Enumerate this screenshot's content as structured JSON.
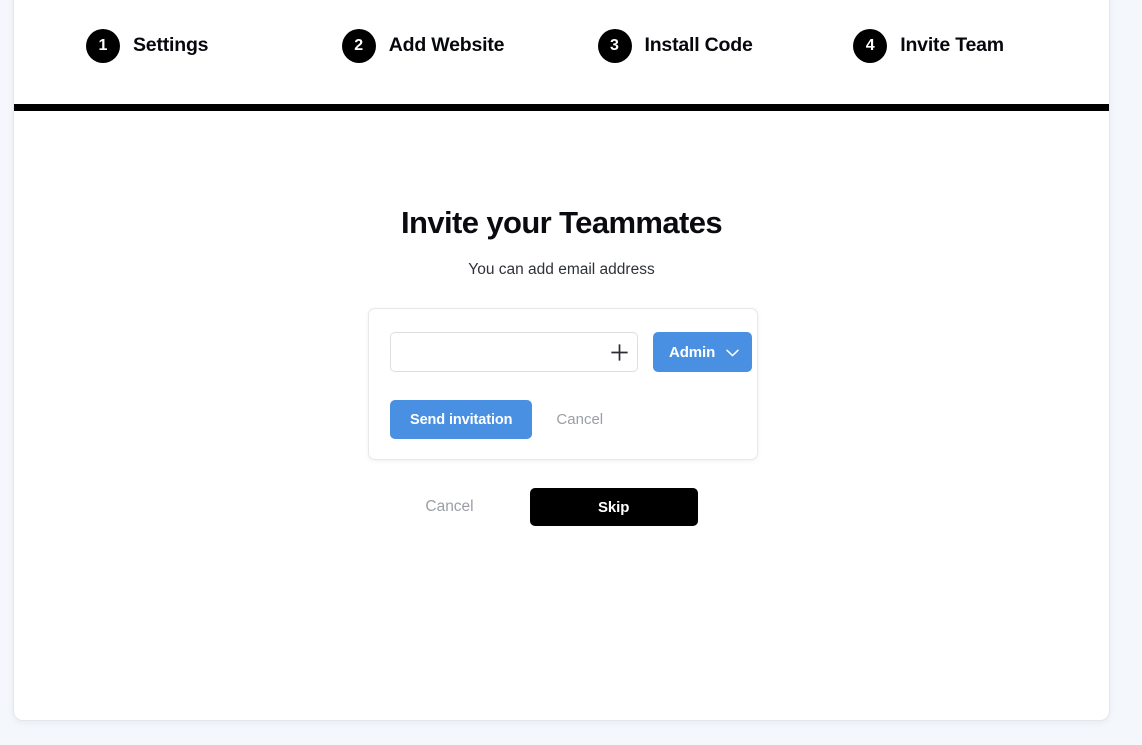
{
  "stepper": {
    "steps": [
      {
        "number": "1",
        "label": "Settings"
      },
      {
        "number": "2",
        "label": "Add Website"
      },
      {
        "number": "3",
        "label": "Install Code"
      },
      {
        "number": "4",
        "label": "Invite Team"
      }
    ]
  },
  "main": {
    "title": "Invite your Teammates",
    "subtitle": "You can add email address"
  },
  "invite_card": {
    "email_input": {
      "value": "",
      "placeholder": ""
    },
    "add_icon": "plus-icon",
    "role_select": {
      "value": "Admin",
      "chevron_icon": "chevron-down-icon",
      "options": [
        "Admin"
      ]
    },
    "send_label": "Send invitation",
    "cancel_label": "Cancel"
  },
  "footer": {
    "cancel_label": "Cancel",
    "skip_label": "Skip"
  },
  "colors": {
    "accent_blue": "#4a90e2",
    "ink": "#000000",
    "page_background": "#f4f8fd",
    "muted_text": "#9b9fa5"
  }
}
